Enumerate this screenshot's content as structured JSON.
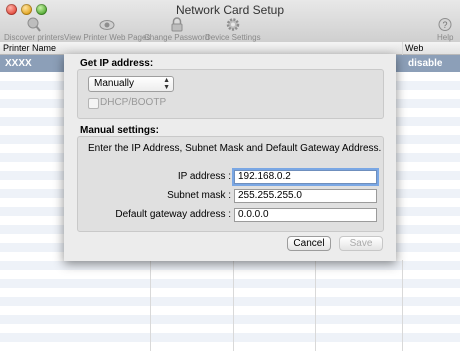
{
  "window": {
    "title": "Network Card Setup"
  },
  "toolbar": {
    "items": [
      {
        "label": "Discover printers",
        "icon": "magnifier-icon"
      },
      {
        "label": "View Printer Web Pages",
        "icon": "eye-icon"
      },
      {
        "label": "Change Password",
        "icon": "lock-icon"
      },
      {
        "label": "Device Settings",
        "icon": "gear-icon"
      },
      {
        "label": "Help",
        "icon": "help-icon"
      }
    ]
  },
  "table": {
    "columns": [
      "Printer Name",
      "Web"
    ],
    "selected_row": {
      "name": "XXXX",
      "web": "disable"
    }
  },
  "sheet": {
    "get_ip_title": "Get IP address:",
    "method_value": "Manually",
    "dhcp_label": "DHCP/BOOTP",
    "manual_title": "Manual settings:",
    "instructions": "Enter the IP Address, Subnet Mask and Default Gateway Address.",
    "fields": {
      "ip_label": "IP address :",
      "ip_value": "192.168.0.2",
      "subnet_label": "Subnet mask :",
      "subnet_value": "255.255.255.0",
      "gateway_label": "Default gateway address :",
      "gateway_value": "0.0.0.0"
    },
    "cancel_label": "Cancel",
    "save_label": "Save"
  }
}
